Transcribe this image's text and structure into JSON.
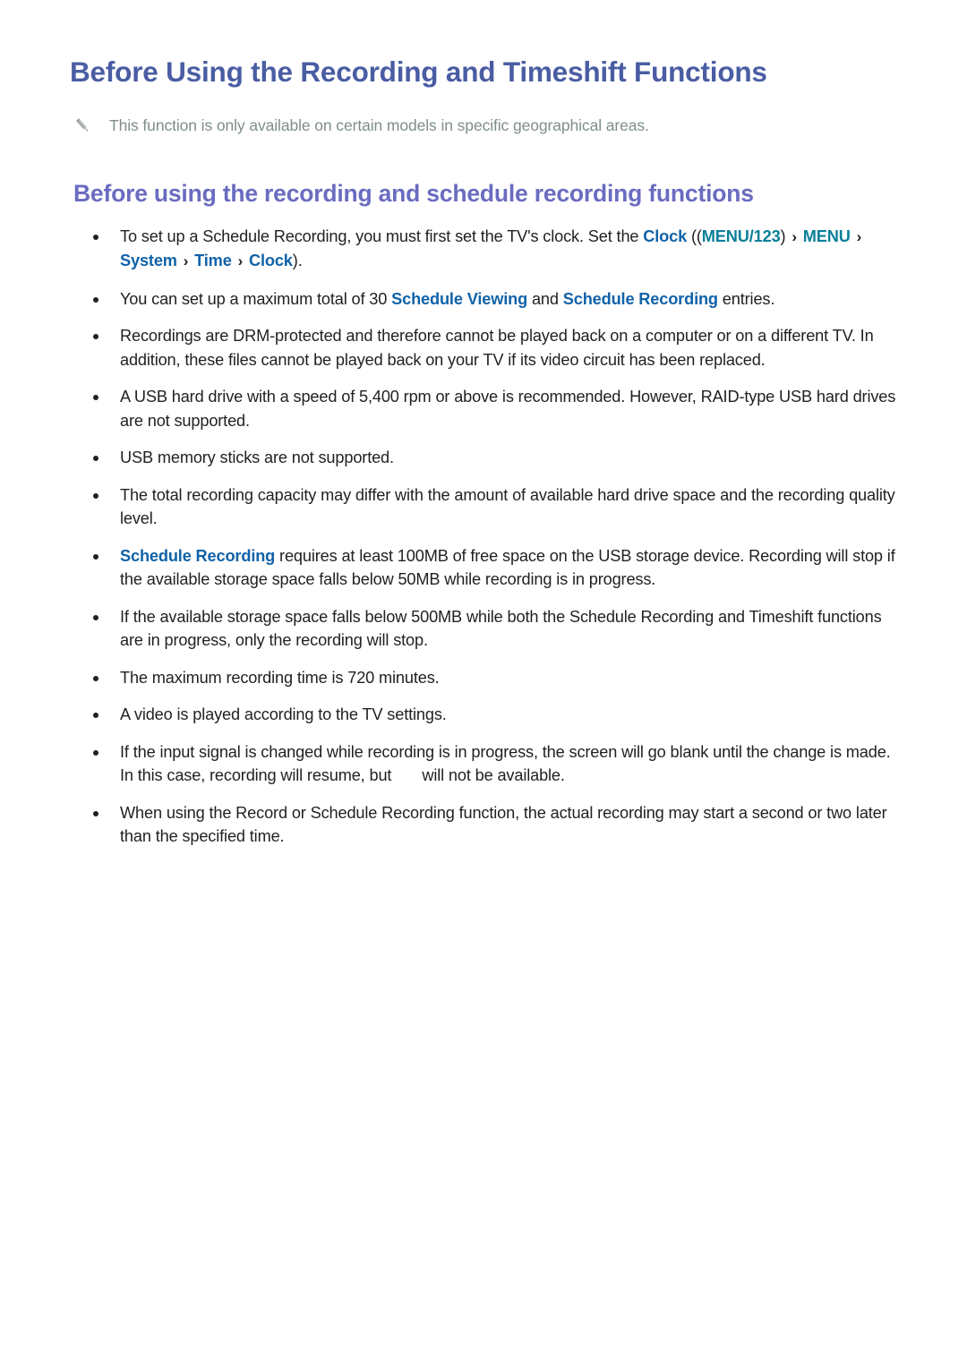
{
  "document": {
    "title": "Before Using the Recording and Timeshift Functions",
    "note_icon": "pencil-icon",
    "note": "This function is only available on certain models in specific geographical areas.",
    "section_heading": "Before using the recording and schedule recording functions"
  },
  "colors": {
    "title": "#4a5da3",
    "section_heading": "#6a6cc0",
    "body_text": "#231f20",
    "note_text": "#7f8e8c",
    "keyword_blue": "#1062a8",
    "keyword_teal": "#0b7f99",
    "background": "#ffffff"
  },
  "bullets": [
    {
      "id": "bullet-clock-setup",
      "parts": [
        {
          "type": "text",
          "value": "To set up a Schedule Recording, you must first set the TV's clock. Set the "
        },
        {
          "type": "blue",
          "value": "Clock"
        },
        {
          "type": "text",
          "value": " (("
        },
        {
          "type": "teal",
          "value": "MENU/123"
        },
        {
          "type": "text",
          "value": ") "
        },
        {
          "type": "chevron",
          "value": "›"
        },
        {
          "type": "text",
          "value": " "
        },
        {
          "type": "teal",
          "value": "MENU"
        },
        {
          "type": "text",
          "value": " "
        },
        {
          "type": "chevron",
          "value": "›"
        },
        {
          "type": "text",
          "value": " "
        },
        {
          "type": "blue",
          "value": "System"
        },
        {
          "type": "text",
          "value": " "
        },
        {
          "type": "chevron",
          "value": "›"
        },
        {
          "type": "text",
          "value": " "
        },
        {
          "type": "blue",
          "value": "Time"
        },
        {
          "type": "text",
          "value": " "
        },
        {
          "type": "chevron",
          "value": "›"
        },
        {
          "type": "text",
          "value": " "
        },
        {
          "type": "blue",
          "value": "Clock"
        },
        {
          "type": "text",
          "value": ")."
        }
      ]
    },
    {
      "id": "bullet-max-entries",
      "parts": [
        {
          "type": "text",
          "value": "You can set up a maximum total of 30 "
        },
        {
          "type": "blue",
          "value": "Schedule Viewing"
        },
        {
          "type": "text",
          "value": " and "
        },
        {
          "type": "blue",
          "value": "Schedule Recording"
        },
        {
          "type": "text",
          "value": " entries."
        }
      ]
    },
    {
      "id": "bullet-drm-protected",
      "parts": [
        {
          "type": "text",
          "value": "Recordings are DRM-protected and therefore cannot be played back on a computer or on a different TV. In addition, these files cannot be played back on your TV if its video circuit has been replaced."
        }
      ]
    },
    {
      "id": "bullet-usb-hard-drive",
      "parts": [
        {
          "type": "text",
          "value": "A USB hard drive with a speed of 5,400 rpm or above is recommended. However, RAID-type USB hard drives are not supported."
        }
      ]
    },
    {
      "id": "bullet-usb-memory-sticks",
      "parts": [
        {
          "type": "text",
          "value": "USB memory sticks are not supported."
        }
      ]
    },
    {
      "id": "bullet-total-capacity",
      "parts": [
        {
          "type": "text",
          "value": "The total recording capacity may differ with the amount of available hard drive space and the recording quality level."
        }
      ]
    },
    {
      "id": "bullet-free-space-100mb",
      "parts": [
        {
          "type": "blue",
          "value": "Schedule Recording"
        },
        {
          "type": "text",
          "value": " requires at least 100MB of free space on the USB storage device. Recording will stop if the available storage space falls below 50MB while recording is in progress."
        }
      ]
    },
    {
      "id": "bullet-free-space-500mb",
      "parts": [
        {
          "type": "text",
          "value": "If the available storage space falls below 500MB while both the Schedule Recording and Timeshift functions are in progress, only the recording will stop."
        }
      ]
    },
    {
      "id": "bullet-max-time",
      "parts": [
        {
          "type": "text",
          "value": "The maximum recording time is 720 minutes."
        }
      ]
    },
    {
      "id": "bullet-video-playback",
      "parts": [
        {
          "type": "text",
          "value": "A video is played according to the TV settings."
        }
      ]
    },
    {
      "id": "bullet-input-signal-change",
      "parts": [
        {
          "type": "text",
          "value": "If the input signal is changed while recording is in progress, the screen will go blank until the change is made. In this case, recording will resume, but"
        },
        {
          "type": "gap",
          "value": ""
        },
        {
          "type": "text",
          "value": "will not be available."
        }
      ]
    },
    {
      "id": "bullet-start-delay",
      "parts": [
        {
          "type": "text",
          "value": "When using the Record or Schedule Recording function, the actual recording may start a second or two later than the specified time."
        }
      ]
    }
  ]
}
